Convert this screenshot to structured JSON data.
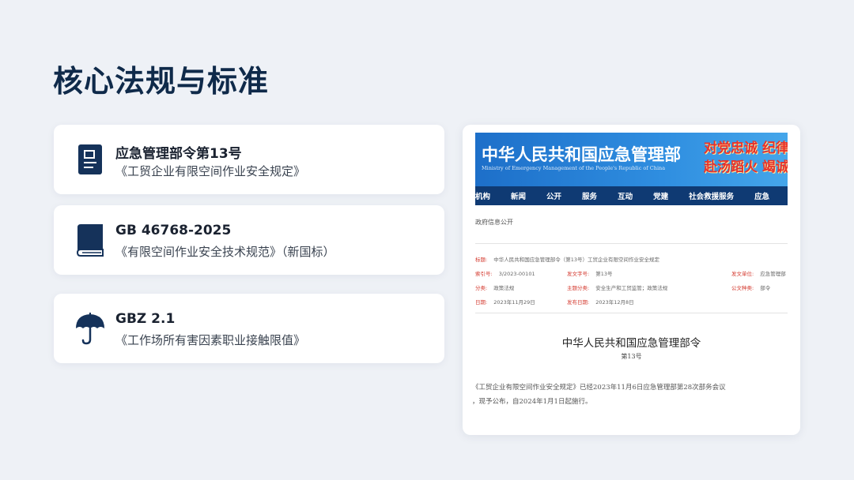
{
  "title": "核心法规与标准",
  "cards": [
    {
      "title": "应急管理部令第13号",
      "subtitle": "《工贸企业有限空间作业安全规定》",
      "icon": "document-icon"
    },
    {
      "title": "GB 46768-2025",
      "subtitle": "《有限空间作业安全技术规范》（新国标）",
      "icon": "book-icon"
    },
    {
      "title": "GBZ 2.1",
      "subtitle": "《工作场所有害因素职业接触限值》",
      "icon": "umbrella-icon"
    }
  ],
  "preview": {
    "org_name": "中华人民共和国应急管理部",
    "org_name_en": "Ministry of Emergency Management of the People's Republic of China",
    "slogan_line1": "对党忠诚 纪律",
    "slogan_line2": "赴汤蹈火 竭诚",
    "nav": [
      "机构",
      "新闻",
      "公开",
      "服务",
      "互动",
      "党建",
      "社会救援服务",
      "应急"
    ],
    "breadcrumb": "政府信息公开",
    "meta": {
      "title_label": "标题:",
      "title_value": "中华人民共和国应急管理部令（第13号）工贸企业有限空间作业安全规定",
      "index_label": "索引号:",
      "index_value": "3/2023-00101",
      "docno_label": "发文字号:",
      "docno_value": "第13号",
      "issuer_label": "发文单位:",
      "issuer_value": "应急管理部",
      "category_label": "分类:",
      "category_value": "政策法规",
      "topic_label": "主题分类:",
      "topic_value": "安全生产和工贸监管；政策法规",
      "public_label": "公文种类:",
      "public_value": "部令",
      "date_label": "日期:",
      "date_value": "2023年11月29日",
      "pubdate_label": "发布日期:",
      "pubdate_value": "2023年12月8日"
    },
    "doc_title": "中华人民共和国应急管理部令",
    "doc_number": "第13号",
    "body_line1": "《工贸企业有限空间作业安全规定》已经2023年11月6日应急管理部第28次部务会议",
    "body_line2": "，现予公布，自2024年1月1日起施行。"
  },
  "colors": {
    "title": "#0f2a4a",
    "icon": "#15325a",
    "background": "#eef1f6",
    "banner": "#2f8ee0",
    "nav": "#0f3a73",
    "label_red": "#d43a2f"
  }
}
